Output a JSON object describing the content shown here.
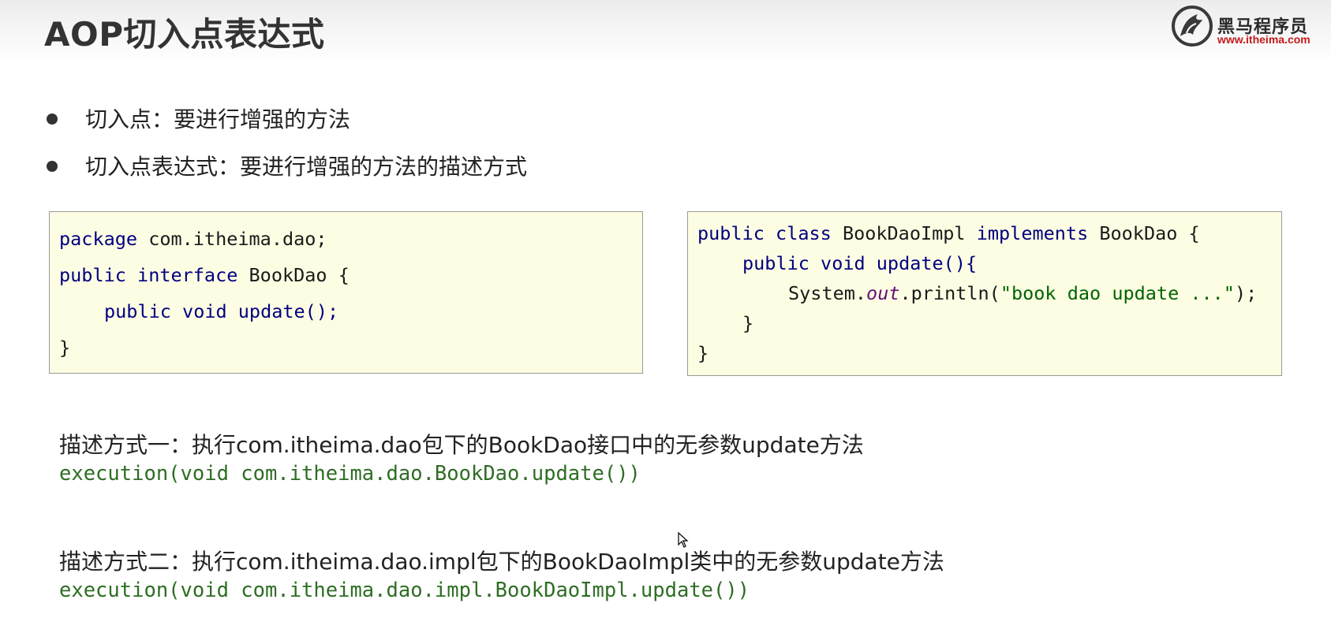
{
  "slide": {
    "title": "AOP切入点表达式",
    "logo": {
      "name_cn": "黑马程序员",
      "url": "www.itheima.com",
      "icon": "horse-logo-icon"
    },
    "bullets": [
      "切入点：要进行增强的方法",
      "切入点表达式：要进行增强的方法的描述方式"
    ],
    "code_interface": {
      "l1_kw": "package",
      "l1_rest": " com.itheima.dao;",
      "l2_kw1": "public",
      "l2_kw2": "interface",
      "l2_rest": " BookDao {",
      "l3_kw1": "public",
      "l3_kw2": "void",
      "l3_rest": " update();",
      "l4": "}"
    },
    "code_impl": {
      "l1_kw1": "public",
      "l1_kw2": "class",
      "l1_mid": " BookDaoImpl ",
      "l1_kw3": "implements",
      "l1_rest": " BookDao {",
      "l2_kw1": "public",
      "l2_kw2": "void",
      "l2_rest": " update(){",
      "l3_a": "System.",
      "l3_out": "out",
      "l3_b": ".println(",
      "l3_str": "\"book dao update ...\"",
      "l3_c": ");",
      "l4": "}",
      "l5": "}"
    },
    "desc1": "描述方式一：执行com.itheima.dao包下的BookDao接口中的无参数update方法",
    "expr1": "execution(void com.itheima.dao.BookDao.update())",
    "desc2": "描述方式二：执行com.itheima.dao.impl包下的BookDaoImpl类中的无参数update方法",
    "expr2": "execution(void com.itheima.dao.impl.BookDaoImpl.update())",
    "colors": {
      "keyword": "#000080",
      "string": "#006400",
      "expression": "#2e6d24",
      "logo_url": "#c41a1a",
      "code_bg": "#fdfde3"
    }
  }
}
